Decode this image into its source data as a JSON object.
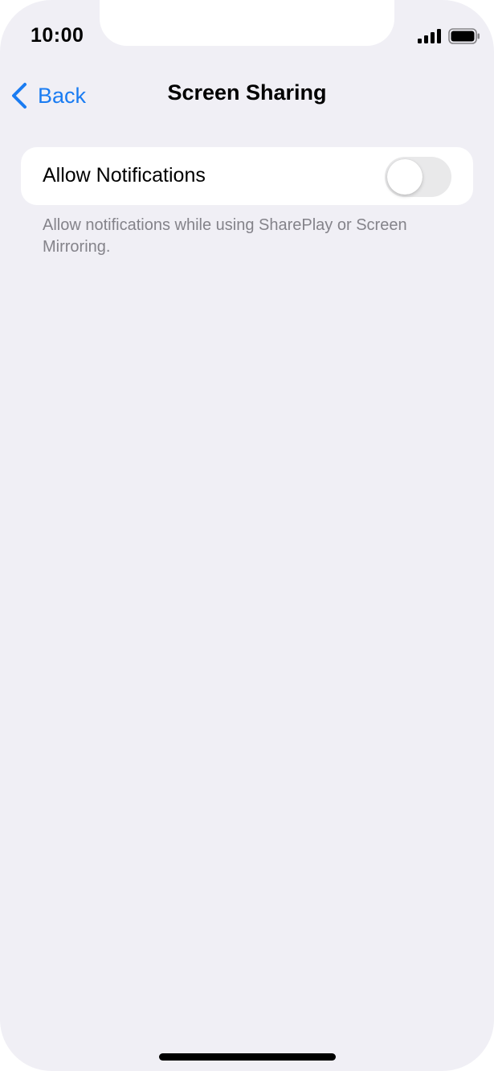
{
  "status_bar": {
    "time": "10:00",
    "signal_icon": "cellular-signal-icon",
    "battery_icon": "battery-full-icon"
  },
  "nav": {
    "back_label": "Back",
    "back_icon": "chevron-left-icon",
    "title": "Screen Sharing"
  },
  "settings": {
    "allow_notifications": {
      "label": "Allow Notifications",
      "enabled": false
    },
    "footnote": "Allow notifications while using SharePlay or Screen Mirroring."
  },
  "colors": {
    "accent": "#1a7cf2",
    "background": "#f0eff5",
    "footnote": "#84838a",
    "toggle_off": "#e9e9ea"
  }
}
